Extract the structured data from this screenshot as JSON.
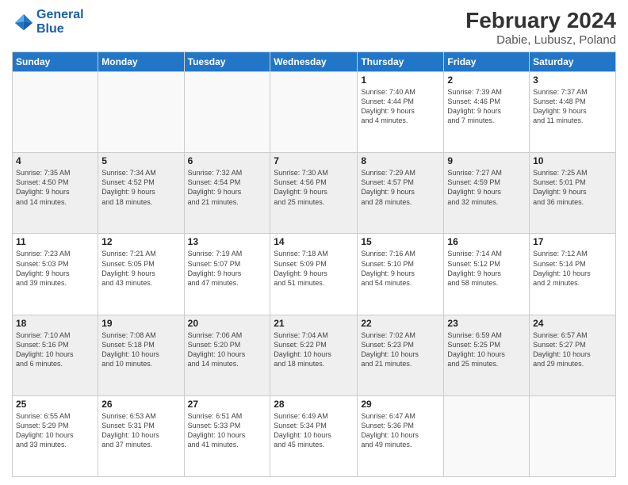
{
  "header": {
    "logo_line1": "General",
    "logo_line2": "Blue",
    "title": "February 2024",
    "subtitle": "Dabie, Lubusz, Poland"
  },
  "weekdays": [
    "Sunday",
    "Monday",
    "Tuesday",
    "Wednesday",
    "Thursday",
    "Friday",
    "Saturday"
  ],
  "weeks": [
    [
      {
        "day": "",
        "info": ""
      },
      {
        "day": "",
        "info": ""
      },
      {
        "day": "",
        "info": ""
      },
      {
        "day": "",
        "info": ""
      },
      {
        "day": "1",
        "info": "Sunrise: 7:40 AM\nSunset: 4:44 PM\nDaylight: 9 hours\nand 4 minutes."
      },
      {
        "day": "2",
        "info": "Sunrise: 7:39 AM\nSunset: 4:46 PM\nDaylight: 9 hours\nand 7 minutes."
      },
      {
        "day": "3",
        "info": "Sunrise: 7:37 AM\nSunset: 4:48 PM\nDaylight: 9 hours\nand 11 minutes."
      }
    ],
    [
      {
        "day": "4",
        "info": "Sunrise: 7:35 AM\nSunset: 4:50 PM\nDaylight: 9 hours\nand 14 minutes."
      },
      {
        "day": "5",
        "info": "Sunrise: 7:34 AM\nSunset: 4:52 PM\nDaylight: 9 hours\nand 18 minutes."
      },
      {
        "day": "6",
        "info": "Sunrise: 7:32 AM\nSunset: 4:54 PM\nDaylight: 9 hours\nand 21 minutes."
      },
      {
        "day": "7",
        "info": "Sunrise: 7:30 AM\nSunset: 4:56 PM\nDaylight: 9 hours\nand 25 minutes."
      },
      {
        "day": "8",
        "info": "Sunrise: 7:29 AM\nSunset: 4:57 PM\nDaylight: 9 hours\nand 28 minutes."
      },
      {
        "day": "9",
        "info": "Sunrise: 7:27 AM\nSunset: 4:59 PM\nDaylight: 9 hours\nand 32 minutes."
      },
      {
        "day": "10",
        "info": "Sunrise: 7:25 AM\nSunset: 5:01 PM\nDaylight: 9 hours\nand 36 minutes."
      }
    ],
    [
      {
        "day": "11",
        "info": "Sunrise: 7:23 AM\nSunset: 5:03 PM\nDaylight: 9 hours\nand 39 minutes."
      },
      {
        "day": "12",
        "info": "Sunrise: 7:21 AM\nSunset: 5:05 PM\nDaylight: 9 hours\nand 43 minutes."
      },
      {
        "day": "13",
        "info": "Sunrise: 7:19 AM\nSunset: 5:07 PM\nDaylight: 9 hours\nand 47 minutes."
      },
      {
        "day": "14",
        "info": "Sunrise: 7:18 AM\nSunset: 5:09 PM\nDaylight: 9 hours\nand 51 minutes."
      },
      {
        "day": "15",
        "info": "Sunrise: 7:16 AM\nSunset: 5:10 PM\nDaylight: 9 hours\nand 54 minutes."
      },
      {
        "day": "16",
        "info": "Sunrise: 7:14 AM\nSunset: 5:12 PM\nDaylight: 9 hours\nand 58 minutes."
      },
      {
        "day": "17",
        "info": "Sunrise: 7:12 AM\nSunset: 5:14 PM\nDaylight: 10 hours\nand 2 minutes."
      }
    ],
    [
      {
        "day": "18",
        "info": "Sunrise: 7:10 AM\nSunset: 5:16 PM\nDaylight: 10 hours\nand 6 minutes."
      },
      {
        "day": "19",
        "info": "Sunrise: 7:08 AM\nSunset: 5:18 PM\nDaylight: 10 hours\nand 10 minutes."
      },
      {
        "day": "20",
        "info": "Sunrise: 7:06 AM\nSunset: 5:20 PM\nDaylight: 10 hours\nand 14 minutes."
      },
      {
        "day": "21",
        "info": "Sunrise: 7:04 AM\nSunset: 5:22 PM\nDaylight: 10 hours\nand 18 minutes."
      },
      {
        "day": "22",
        "info": "Sunrise: 7:02 AM\nSunset: 5:23 PM\nDaylight: 10 hours\nand 21 minutes."
      },
      {
        "day": "23",
        "info": "Sunrise: 6:59 AM\nSunset: 5:25 PM\nDaylight: 10 hours\nand 25 minutes."
      },
      {
        "day": "24",
        "info": "Sunrise: 6:57 AM\nSunset: 5:27 PM\nDaylight: 10 hours\nand 29 minutes."
      }
    ],
    [
      {
        "day": "25",
        "info": "Sunrise: 6:55 AM\nSunset: 5:29 PM\nDaylight: 10 hours\nand 33 minutes."
      },
      {
        "day": "26",
        "info": "Sunrise: 6:53 AM\nSunset: 5:31 PM\nDaylight: 10 hours\nand 37 minutes."
      },
      {
        "day": "27",
        "info": "Sunrise: 6:51 AM\nSunset: 5:33 PM\nDaylight: 10 hours\nand 41 minutes."
      },
      {
        "day": "28",
        "info": "Sunrise: 6:49 AM\nSunset: 5:34 PM\nDaylight: 10 hours\nand 45 minutes."
      },
      {
        "day": "29",
        "info": "Sunrise: 6:47 AM\nSunset: 5:36 PM\nDaylight: 10 hours\nand 49 minutes."
      },
      {
        "day": "",
        "info": ""
      },
      {
        "day": "",
        "info": ""
      }
    ]
  ]
}
